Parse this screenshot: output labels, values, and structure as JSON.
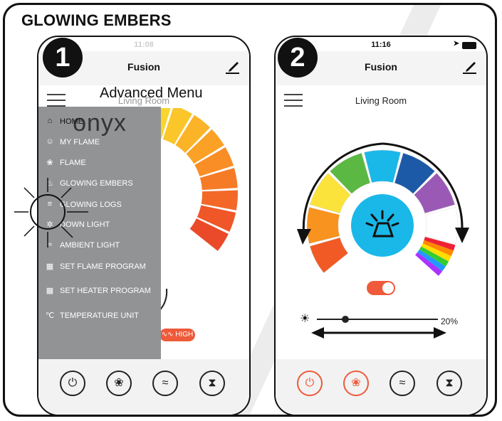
{
  "manual_title": "GLOWING EMBERS",
  "step1": {
    "badge": "1",
    "status_time": "11:08",
    "app_title": "Fusion",
    "room": "Living Room",
    "overlay_caption": "Advanced Menu",
    "drawer": {
      "logo": "onyx",
      "items": [
        {
          "icon": "home-icon",
          "label": "HOME"
        },
        {
          "icon": "user-icon",
          "label": "MY FLAME"
        },
        {
          "icon": "flame-icon",
          "label": "FLAME"
        },
        {
          "icon": "embers-icon",
          "label": "GLOWING EMBERS"
        },
        {
          "icon": "logs-icon",
          "label": "GLOWING LOGS"
        },
        {
          "icon": "downlight-icon",
          "label": "DOWN LIGHT"
        },
        {
          "icon": "ambient-icon",
          "label": "AMBIENT LIGHT"
        },
        {
          "icon": "calendar-icon",
          "label": "SET FLAME PROGRAM"
        },
        {
          "icon": "calendar-icon",
          "label": "SET HEATER PROGRAM"
        },
        {
          "icon": "thermometer-icon",
          "label": "TEMPERATURE UNIT"
        }
      ]
    },
    "heater_badge": "HIGH"
  },
  "step2": {
    "badge": "2",
    "status_time": "11:16",
    "app_title": "Fusion",
    "room": "Living Room",
    "brightness_value": "20%",
    "brightness_fraction": 0.2,
    "toggle_on": true
  },
  "bottom_nav": [
    "power-icon",
    "flame-icon",
    "heat-icon",
    "timer-icon"
  ],
  "colors": {
    "accent": "#ee5a3a",
    "drawer_bg": "#919395",
    "ember_blue": "#1ab8e8"
  }
}
